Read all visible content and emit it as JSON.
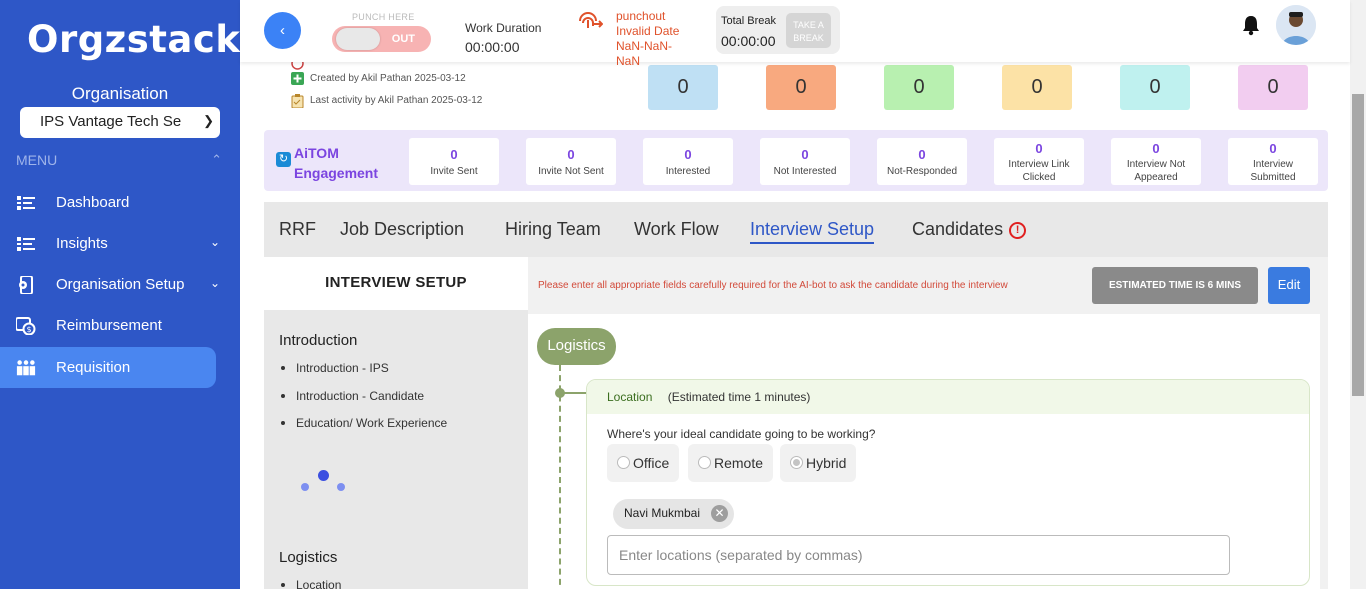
{
  "sidebar": {
    "logo": "Orgzstack",
    "org_label": "Organisation",
    "org_select": "IPS Vantage Tech Se",
    "menu_label": "MENU",
    "items": [
      {
        "label": "Dashboard",
        "icon": "dashboard-icon"
      },
      {
        "label": "Insights",
        "icon": "insights-icon"
      },
      {
        "label": "Organisation Setup",
        "icon": "org-setup-icon"
      },
      {
        "label": "Reimbursement",
        "icon": "reimbursement-icon"
      },
      {
        "label": "Requisition",
        "icon": "requisition-icon"
      }
    ]
  },
  "topbar": {
    "punch_label": "PUNCH HERE",
    "punch_state": "OUT",
    "work_duration_label": "Work Duration",
    "work_duration_value": "00:00:00",
    "punchout_line1": "punchout",
    "punchout_line2": "Invalid Date",
    "punchout_line3": "NaN-NaN-",
    "punchout_line4": "NaN",
    "total_break_label": "Total Break",
    "total_break_value": "00:00:00",
    "take_break_line1": "TAKE A",
    "take_break_line2": "BREAK"
  },
  "meta": {
    "created_by": "Created by Akil Pathan 2025-03-12",
    "last_activity": "Last activity by Akil Pathan 2025-03-12"
  },
  "count_boxes": [
    {
      "value": "0",
      "color": "#bfe0f4"
    },
    {
      "value": "0",
      "color": "#f8a97f"
    },
    {
      "value": "0",
      "color": "#b8f0b0"
    },
    {
      "value": "0",
      "color": "#fce2a6"
    },
    {
      "value": "0",
      "color": "#bff1ef"
    },
    {
      "value": "0",
      "color": "#f2cdf0"
    }
  ],
  "aitom": {
    "title_line1": "AiTOM",
    "title_line2": "Engagement",
    "stats": [
      {
        "value": "0",
        "label": "Invite Sent"
      },
      {
        "value": "0",
        "label": "Invite Not Sent"
      },
      {
        "value": "0",
        "label": "Interested"
      },
      {
        "value": "0",
        "label": "Not Interested"
      },
      {
        "value": "0",
        "label": "Not-Responded"
      },
      {
        "value": "0",
        "label1": "Interview Link",
        "label2": "Clicked"
      },
      {
        "value": "0",
        "label1": "Interview Not",
        "label2": "Appeared"
      },
      {
        "value": "0",
        "label1": "Interview",
        "label2": "Submitted"
      }
    ]
  },
  "tabs": [
    "RRF",
    "Job Description",
    "Hiring Team",
    "Work Flow",
    "Interview Setup",
    "Candidates"
  ],
  "interview_setup": {
    "heading": "INTERVIEW SETUP",
    "note": "Please enter all appropriate fields carefully required for the AI-bot to ask the candidate during the interview",
    "estimated_time": "ESTIMATED TIME IS 6 MINS",
    "edit_label": "Edit",
    "sections": [
      {
        "title": "Introduction",
        "items": [
          "Introduction - IPS",
          "Introduction - Candidate",
          "Education/ Work Experience"
        ]
      },
      {
        "title": "Logistics",
        "items": [
          "Location"
        ]
      }
    ]
  },
  "logistics": {
    "pill": "Logistics",
    "card_label": "Location",
    "card_time": "(Estimated time 1 minutes)",
    "question": "Where's your ideal candidate going to be working?",
    "options": [
      "Office",
      "Remote",
      "Hybrid"
    ],
    "selected": "Hybrid",
    "chip": "Navi Mukmbai",
    "input_placeholder": "Enter locations (separated by commas)"
  }
}
